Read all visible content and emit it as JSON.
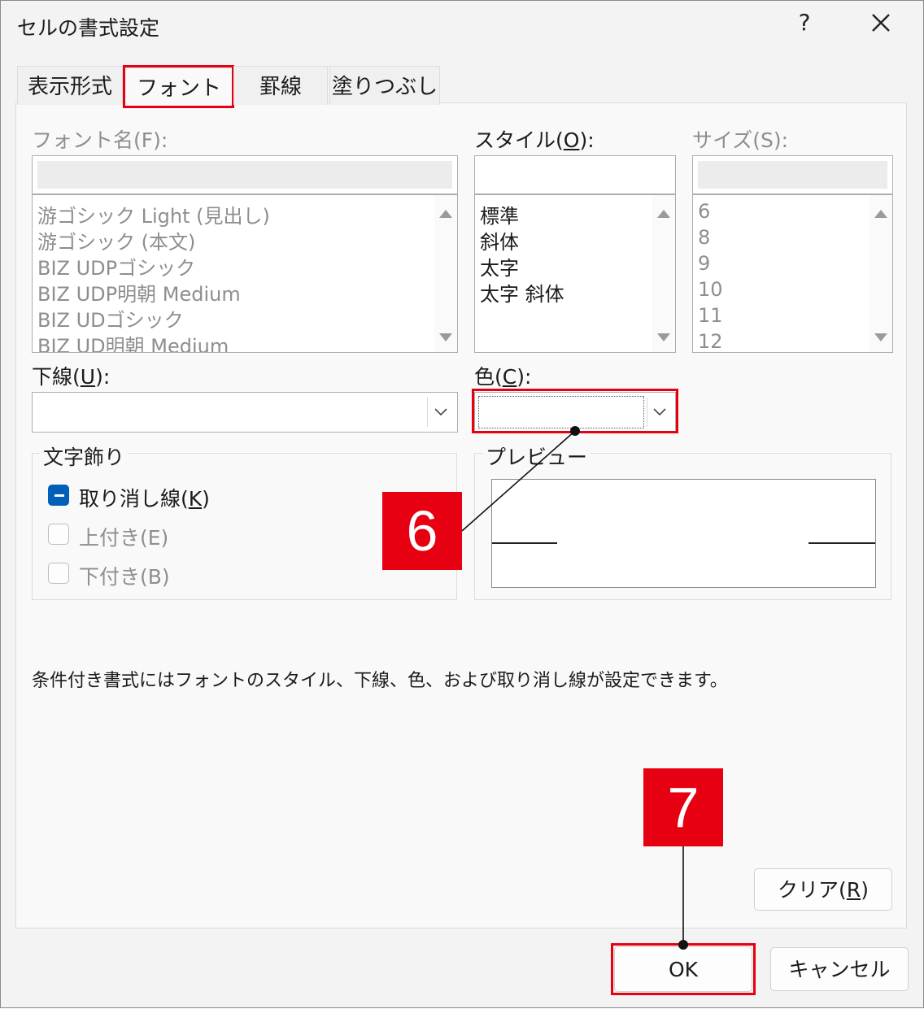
{
  "dialog": {
    "title": "セルの書式設定",
    "help_label": "?",
    "close_label": "✕"
  },
  "tabs": [
    {
      "label": "表示形式",
      "active": false
    },
    {
      "label": "フォント",
      "active": true
    },
    {
      "label": "罫線",
      "active": false
    },
    {
      "label": "塗りつぶし",
      "active": false
    }
  ],
  "font_name": {
    "label": "フォント名(F):",
    "value": "",
    "items": [
      "游ゴシック Light (見出し)",
      "游ゴシック (本文)",
      "BIZ UDPゴシック",
      "BIZ UDP明朝 Medium",
      "BIZ UDゴシック",
      "BIZ UD明朝 Medium"
    ]
  },
  "style": {
    "label_pre": "スタイル(",
    "label_key": "O",
    "label_post": "):",
    "value": "",
    "items": [
      "標準",
      "斜体",
      "太字",
      "太字 斜体"
    ]
  },
  "size": {
    "label": "サイズ(S):",
    "value": "",
    "items": [
      "6",
      "8",
      "9",
      "10",
      "11",
      "12"
    ]
  },
  "underline": {
    "label_pre": "下線(",
    "label_key": "U",
    "label_post": "):",
    "value": ""
  },
  "color": {
    "label_pre": "色(",
    "label_key": "C",
    "label_post": "):",
    "value": ""
  },
  "effects": {
    "legend": "文字飾り",
    "strikethrough_pre": "取り消し線(",
    "strikethrough_key": "K",
    "strikethrough_post": ")",
    "strikethrough_state": "indeterminate",
    "superscript": "上付き(E)",
    "subscript": "下付き(B)"
  },
  "preview": {
    "legend": "プレビュー"
  },
  "note": "条件付き書式にはフォントのスタイル、下線、色、および取り消し線が設定できます。",
  "clear_button": {
    "pre": "クリア(",
    "key": "R",
    "post": ")"
  },
  "ok_button": "OK",
  "cancel_button": "キャンセル",
  "annotations": {
    "step6": "6",
    "step7": "7",
    "color": "#e60012"
  },
  "colors": {
    "accent": "#005fb8",
    "highlight_red": "#e60012"
  }
}
